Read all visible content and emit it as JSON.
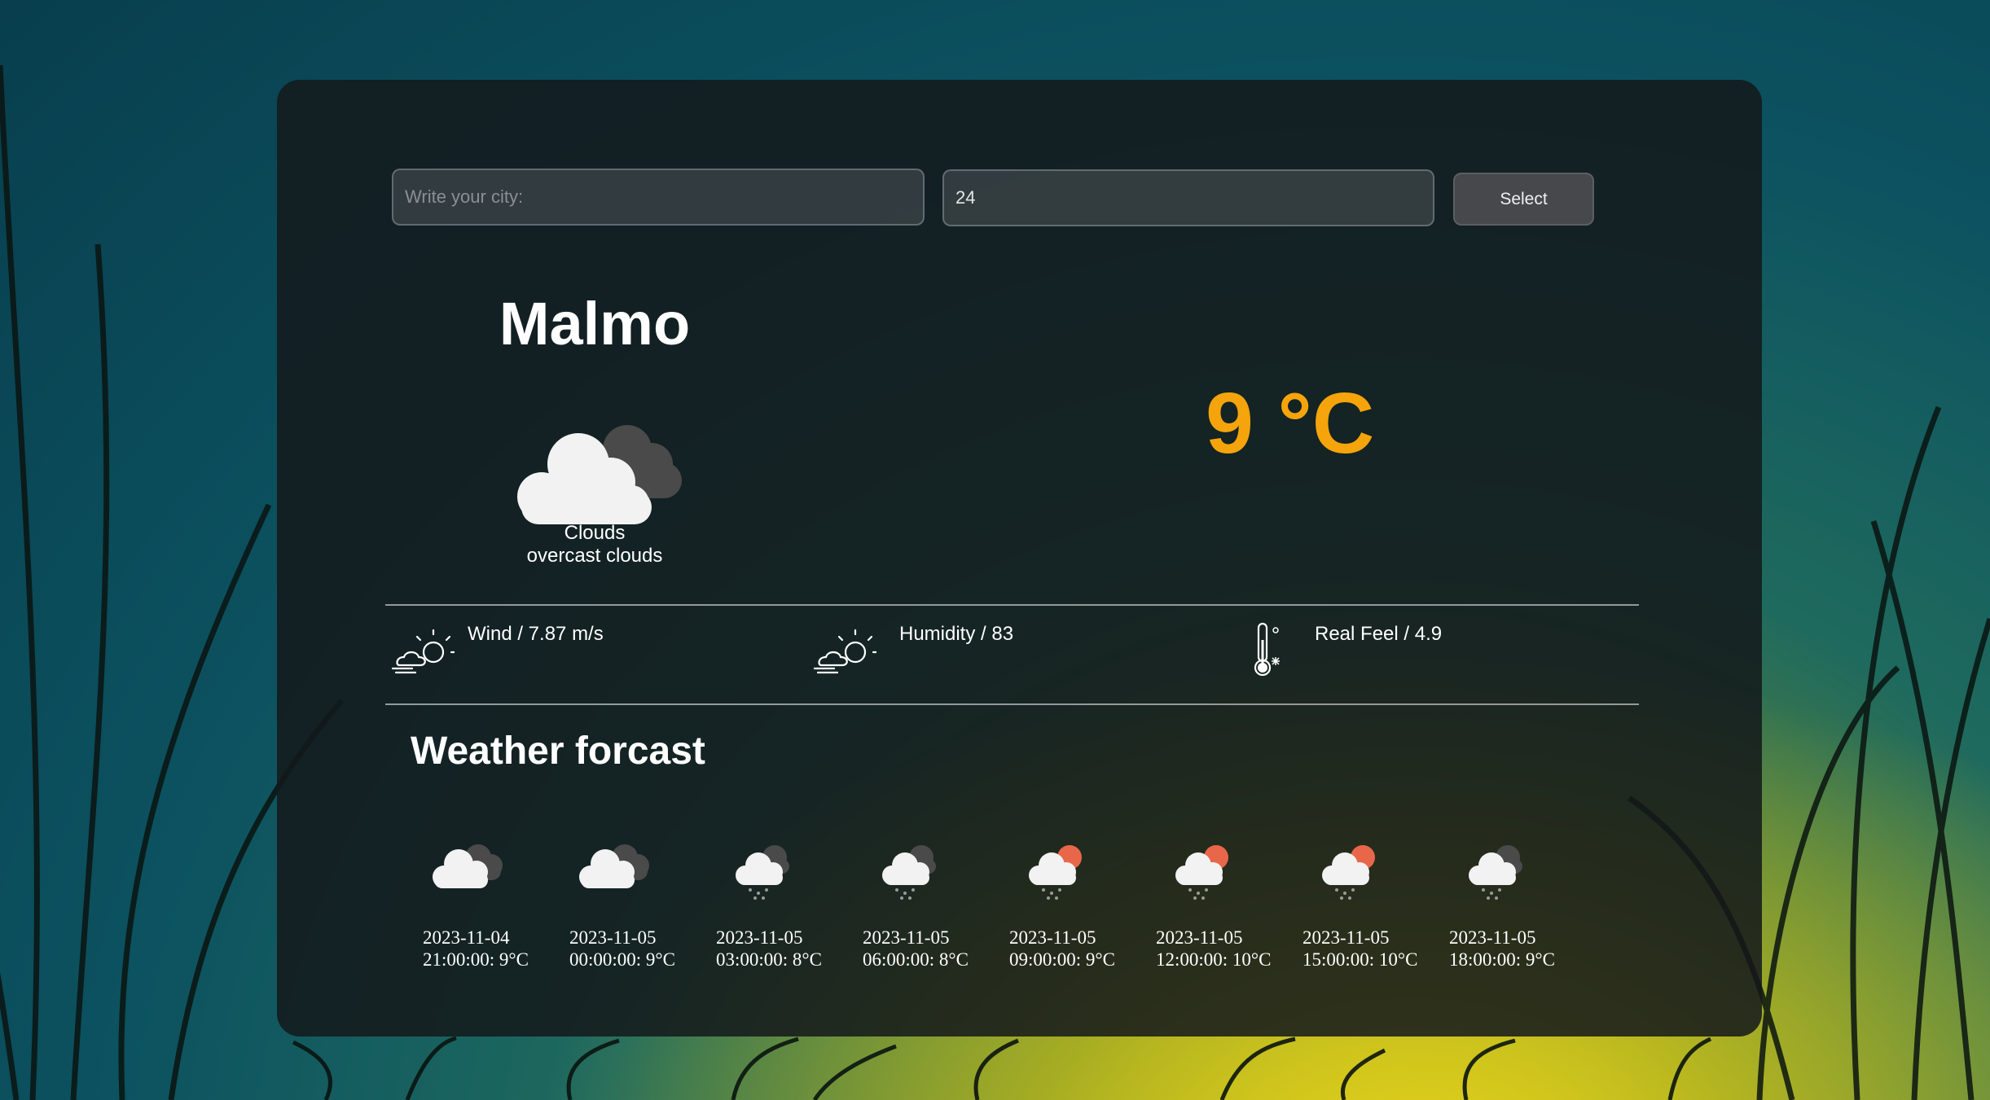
{
  "search": {
    "city_placeholder": "Write your city:",
    "city_value": "",
    "count_value": "24",
    "select_label": "Select"
  },
  "current": {
    "city": "Malmo",
    "temperature": "9 °C",
    "condition": "Clouds",
    "description": "overcast clouds",
    "icon": "overcast-clouds-icon"
  },
  "stats": {
    "wind": "Wind / 7.87 m/s",
    "humidity": "Humidity / 83",
    "real_feel": "Real Feel / 4.9"
  },
  "forecast": {
    "title": "Weather forcast",
    "items": [
      {
        "date": "2023-11-04",
        "time_temp": "21:00:00: 9°C",
        "icon": "overcast-clouds-icon"
      },
      {
        "date": "2023-11-05",
        "time_temp": "00:00:00: 9°C",
        "icon": "overcast-clouds-icon"
      },
      {
        "date": "2023-11-05",
        "time_temp": "03:00:00: 8°C",
        "icon": "rain-cloud-icon"
      },
      {
        "date": "2023-11-05",
        "time_temp": "06:00:00: 8°C",
        "icon": "rain-cloud-icon"
      },
      {
        "date": "2023-11-05",
        "time_temp": "09:00:00: 9°C",
        "icon": "sun-rain-cloud-icon"
      },
      {
        "date": "2023-11-05",
        "time_temp": "12:00:00: 10°C",
        "icon": "sun-rain-cloud-icon"
      },
      {
        "date": "2023-11-05",
        "time_temp": "15:00:00: 10°C",
        "icon": "sun-rain-cloud-icon"
      },
      {
        "date": "2023-11-05",
        "time_temp": "18:00:00: 9°C",
        "icon": "rain-cloud-icon"
      }
    ]
  },
  "colors": {
    "temperature": "#f5a40b",
    "sun": "#e8674a",
    "panel": "#14181b"
  }
}
